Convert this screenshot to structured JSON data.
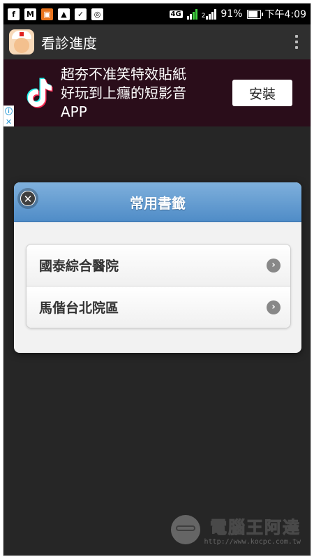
{
  "status_bar": {
    "left_icons": [
      "facebook-icon",
      "gmail-icon",
      "app-notification-icon",
      "image-icon",
      "delivery-icon",
      "location-icon"
    ],
    "network": "4G",
    "sim_slot": "2",
    "battery": "91%",
    "time": "下午4:09"
  },
  "app_bar": {
    "title": "看診進度"
  },
  "ad": {
    "line1": "超夯不准笑特效貼紙",
    "line2": "好玩到上癮的短影音",
    "line3": "APP",
    "button_label": "安裝",
    "info_icon": "info-icon",
    "close_icon": "close-icon"
  },
  "dialog": {
    "title": "常用書籤",
    "items": [
      {
        "label": "國泰綜合醫院"
      },
      {
        "label": "馬偕台北院區"
      }
    ]
  },
  "watermark": {
    "brand": "電腦王阿達",
    "url": "http://www.kocpc.com.tw"
  },
  "colors": {
    "background": "#262626",
    "dialog_header": "#5b97cf",
    "ad_background": "#2a0d1a"
  }
}
